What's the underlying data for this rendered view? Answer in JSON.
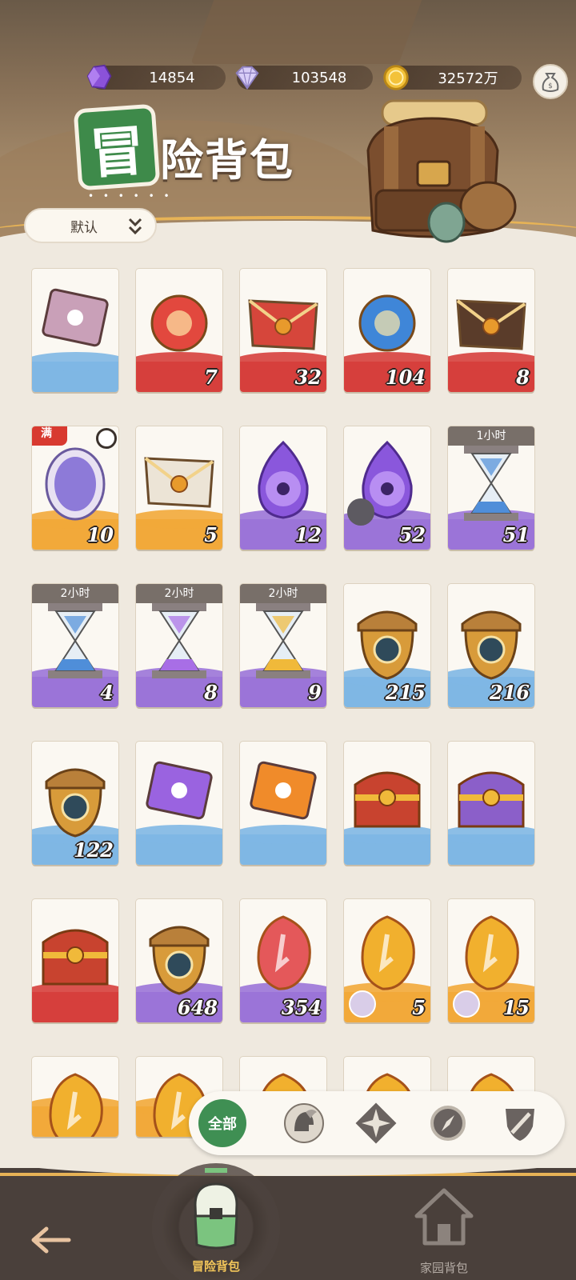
{
  "currencies": [
    {
      "icon": "purple-crystal-icon",
      "value": "14854"
    },
    {
      "icon": "diamond-icon",
      "value": "103548"
    },
    {
      "icon": "gold-coin-icon",
      "value": "32572万"
    }
  ],
  "title": {
    "badge": "冒",
    "rest": "险背包",
    "dots": "• • • • • •"
  },
  "sort": {
    "label": "默认"
  },
  "items": [
    {
      "icon": "ticket-icon",
      "qty": "",
      "band": "blue"
    },
    {
      "icon": "red-emblem-icon",
      "qty": "7",
      "band": "red"
    },
    {
      "icon": "red-envelope-icon",
      "qty": "32",
      "band": "red"
    },
    {
      "icon": "blue-orb-icon",
      "qty": "104",
      "band": "red"
    },
    {
      "icon": "dark-envelope-icon",
      "qty": "8",
      "band": "red"
    },
    {
      "icon": "crystal-egg-icon",
      "qty": "10",
      "band": "gold",
      "tag": "满"
    },
    {
      "icon": "white-envelope-icon",
      "qty": "5",
      "band": "gold"
    },
    {
      "icon": "purple-eye-flame-icon",
      "qty": "12",
      "band": "purple"
    },
    {
      "icon": "purple-trident-flame-icon",
      "qty": "52",
      "band": "purple"
    },
    {
      "icon": "hourglass-blue-icon",
      "qty": "51",
      "band": "purple",
      "timer": "1小时"
    },
    {
      "icon": "hourglass-blue-icon",
      "qty": "4",
      "band": "purple",
      "timer": "2小时"
    },
    {
      "icon": "hourglass-purple-icon",
      "qty": "8",
      "band": "purple",
      "timer": "2小时"
    },
    {
      "icon": "hourglass-gold-icon",
      "qty": "9",
      "band": "purple",
      "timer": "2小时"
    },
    {
      "icon": "acorn-eye-icon",
      "qty": "215",
      "band": "blue"
    },
    {
      "icon": "acorn-leaf-icon",
      "qty": "216",
      "band": "blue"
    },
    {
      "icon": "acorn-star-icon",
      "qty": "122",
      "band": "blue"
    },
    {
      "icon": "purple-ticket-icon",
      "qty": "",
      "band": "blue"
    },
    {
      "icon": "orange-ticket-icon",
      "qty": "",
      "band": "blue"
    },
    {
      "icon": "red-chest-icon",
      "qty": "",
      "band": "blue"
    },
    {
      "icon": "purple-chest-icon",
      "qty": "",
      "band": "blue"
    },
    {
      "icon": "red-chest-icon",
      "qty": "",
      "band": "red"
    },
    {
      "icon": "acorn-diamond-icon",
      "qty": "648",
      "band": "purple"
    },
    {
      "icon": "red-shard-icon",
      "qty": "354",
      "band": "purple"
    },
    {
      "icon": "gold-shard-icon",
      "qty": "5",
      "band": "gold",
      "avatar": true
    },
    {
      "icon": "gold-shard-icon",
      "qty": "15",
      "band": "gold",
      "avatar": true
    },
    {
      "icon": "gold-shard-icon",
      "qty": "",
      "band": "gold"
    },
    {
      "icon": "gold-shard-icon",
      "qty": "",
      "band": "gold"
    },
    {
      "icon": "gold-shard-icon",
      "qty": "",
      "band": "gold"
    },
    {
      "icon": "gold-shard-icon",
      "qty": "",
      "band": "gold"
    },
    {
      "icon": "gold-shard-icon",
      "qty": "",
      "band": "gold"
    }
  ],
  "filter": {
    "all_label": "全部",
    "categories": [
      "helmet-icon",
      "star-compass-icon",
      "compass-icon",
      "sword-shield-icon"
    ]
  },
  "nav": {
    "back_icon": "back-arrow-icon",
    "adventure_label": "冒险背包",
    "home_label": "家园背包"
  },
  "colors": {
    "accent_green": "#3f8f53",
    "band_red": "#d63f3c",
    "band_gold": "#f2a93a",
    "band_purple": "#9b74d8",
    "band_blue": "#7fb7e4",
    "nav_bg": "#4a403b"
  }
}
